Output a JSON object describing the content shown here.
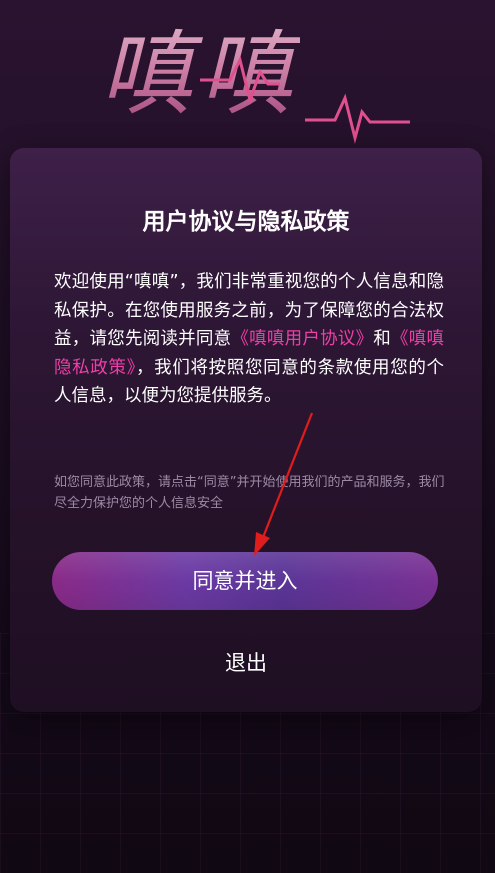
{
  "app": {
    "logo_text": "嗔嗔"
  },
  "dialog": {
    "title": "用户协议与隐私政策",
    "body_part1": "欢迎使用“嗔嗔”，我们非常重视您的个人信息和隐私保护。在您使用服务之前，为了保障您的合法权益，请您先阅读并同意",
    "user_agreement_link": "《嗔嗔用户协议》",
    "body_and": "和",
    "privacy_policy_link": "《嗔嗔隐私政策》",
    "body_part2": "，我们将按照您同意的条款使用您的个人信息，以便为您提供服务。",
    "hint": "如您同意此政策，请点击“同意”并开始使用我们的产品和服务，我们尽全力保护您的个人信息安全",
    "agree_label": "同意并进入",
    "exit_label": "退出"
  },
  "colors": {
    "link": "#ee3fa6",
    "annotation_arrow": "#e01c1c"
  },
  "icons": {
    "annotation": "red-arrow-pointing-to-agree-button"
  }
}
